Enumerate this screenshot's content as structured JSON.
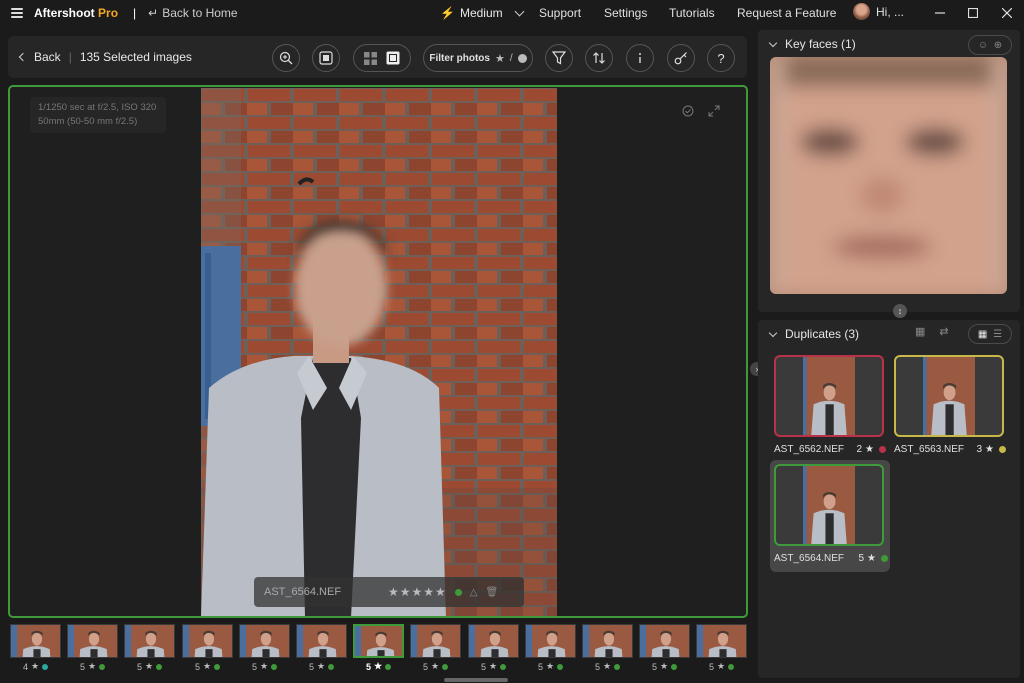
{
  "app": {
    "brand": "Aftershoot",
    "brand_suffix": "Pro",
    "back_home": "Back to Home",
    "mode": "Medium",
    "nav": [
      "Support",
      "Settings",
      "Tutorials",
      "Request a Feature"
    ],
    "user_greeting": "Hi, ...",
    "window_controls": [
      "minimize-icon",
      "maximize-icon",
      "close-icon"
    ]
  },
  "toolbar": {
    "back_label": "Back",
    "selection_count": "135 Selected images",
    "filter_label": "Filter photos",
    "filter_suffix": "/",
    "icons": [
      "zoom-in-icon",
      "single-view-icon",
      "grid-view-icon",
      "loupe-view-icon",
      "filter-icon",
      "sort-icon",
      "info-icon",
      "key-icon",
      "help-icon"
    ]
  },
  "viewer": {
    "exif_line1": "1/1250 sec at f/2.5, ISO 320",
    "exif_line2": "50mm (50-50 mm f/2.5)",
    "filename": "AST_6564.NEF",
    "rating_stars": "★★★★★",
    "color_label": "#3f9a3a"
  },
  "filmstrip": [
    {
      "rating": "4",
      "color": "#2ba8a0"
    },
    {
      "rating": "5",
      "color": "#3f9a3a"
    },
    {
      "rating": "5",
      "color": "#3f9a3a"
    },
    {
      "rating": "5",
      "color": "#3f9a3a"
    },
    {
      "rating": "5",
      "color": "#3f9a3a"
    },
    {
      "rating": "5",
      "color": "#3f9a3a"
    },
    {
      "rating": "5",
      "color": "#3f9a3a",
      "active": true
    },
    {
      "rating": "5",
      "color": "#3f9a3a"
    },
    {
      "rating": "5",
      "color": "#3f9a3a"
    },
    {
      "rating": "5",
      "color": "#3f9a3a"
    },
    {
      "rating": "5",
      "color": "#3f9a3a"
    },
    {
      "rating": "5",
      "color": "#3f9a3a"
    },
    {
      "rating": "5",
      "color": "#3f9a3a"
    }
  ],
  "key_faces": {
    "title": "Key faces (1)"
  },
  "duplicates": {
    "title": "Duplicates (3)",
    "items": [
      {
        "filename": "AST_6562.NEF",
        "rating": "2",
        "color": "#b8324a"
      },
      {
        "filename": "AST_6563.NEF",
        "rating": "3",
        "color": "#c8b84a"
      },
      {
        "filename": "AST_6564.NEF",
        "rating": "5",
        "color": "#3f9a3a",
        "selected": true
      }
    ]
  },
  "colors": {
    "accent_green": "#3f9a3a",
    "brand_orange": "#f5a623",
    "bolt_yellow": "#f5c518"
  }
}
